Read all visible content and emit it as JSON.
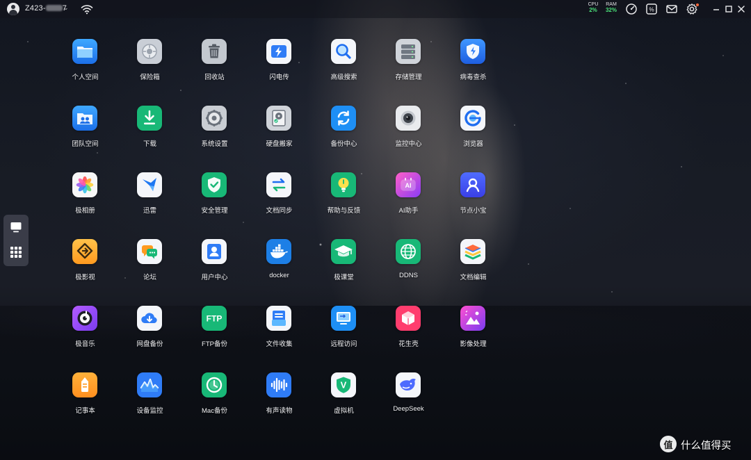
{
  "topbar": {
    "device_name_prefix": "Z423-",
    "device_name_suffix": "7",
    "cpu": {
      "label": "CPU",
      "value": "2%"
    },
    "ram": {
      "label": "RAM",
      "value": "32%"
    }
  },
  "dock": {
    "items": [
      {
        "icon": "desktop-icon"
      },
      {
        "icon": "app-grid-icon"
      }
    ]
  },
  "apps": [
    {
      "label": "个人空间",
      "icon": "personal-space-icon"
    },
    {
      "label": "保险箱",
      "icon": "safe-icon"
    },
    {
      "label": "回收站",
      "icon": "trash-icon"
    },
    {
      "label": "闪电传",
      "icon": "flash-transfer-icon"
    },
    {
      "label": "高级搜索",
      "icon": "search-icon"
    },
    {
      "label": "存储管理",
      "icon": "storage-icon"
    },
    {
      "label": "病毒查杀",
      "icon": "antivirus-icon"
    },
    {
      "label": "团队空间",
      "icon": "team-space-icon"
    },
    {
      "label": "下载",
      "icon": "download-icon"
    },
    {
      "label": "系统设置",
      "icon": "settings-icon"
    },
    {
      "label": "硬盘搬家",
      "icon": "disk-migration-icon"
    },
    {
      "label": "备份中心",
      "icon": "backup-center-icon"
    },
    {
      "label": "监控中心",
      "icon": "camera-icon"
    },
    {
      "label": "浏览器",
      "icon": "browser-icon"
    },
    {
      "label": "极相册",
      "icon": "photos-icon"
    },
    {
      "label": "迅雷",
      "icon": "xunlei-icon"
    },
    {
      "label": "安全管理",
      "icon": "security-icon"
    },
    {
      "label": "文档同步",
      "icon": "doc-sync-icon"
    },
    {
      "label": "帮助与反馈",
      "icon": "help-icon"
    },
    {
      "label": "AI助手",
      "icon": "ai-assistant-icon"
    },
    {
      "label": "节点小宝",
      "icon": "node-icon"
    },
    {
      "label": "极影视",
      "icon": "video-icon"
    },
    {
      "label": "论坛",
      "icon": "forum-icon"
    },
    {
      "label": "用户中心",
      "icon": "user-center-icon"
    },
    {
      "label": "docker",
      "icon": "docker-icon"
    },
    {
      "label": "极课堂",
      "icon": "classroom-icon"
    },
    {
      "label": "DDNS",
      "icon": "ddns-icon"
    },
    {
      "label": "文档编辑",
      "icon": "doc-edit-icon"
    },
    {
      "label": "极音乐",
      "icon": "music-icon"
    },
    {
      "label": "网盘备份",
      "icon": "cloud-backup-icon"
    },
    {
      "label": "FTP备份",
      "icon": "ftp-icon",
      "text": "FTP"
    },
    {
      "label": "文件收集",
      "icon": "file-collect-icon"
    },
    {
      "label": "远程访问",
      "icon": "remote-access-icon"
    },
    {
      "label": "花生壳",
      "icon": "peanut-icon"
    },
    {
      "label": "影像处理",
      "icon": "image-process-icon"
    },
    {
      "label": "记事本",
      "icon": "notepad-icon"
    },
    {
      "label": "设备监控",
      "icon": "device-monitor-icon"
    },
    {
      "label": "Mac备份",
      "icon": "mac-backup-icon"
    },
    {
      "label": "有声读物",
      "icon": "audiobook-icon"
    },
    {
      "label": "虚拟机",
      "icon": "vm-icon",
      "text": "V"
    },
    {
      "label": "DeepSeek",
      "icon": "deepseek-icon"
    }
  ],
  "colors": {
    "cpu_value": "#4be37a",
    "accent_blue": "#2f7cf6"
  },
  "watermark": {
    "glyph": "值",
    "text": "什么值得买"
  }
}
